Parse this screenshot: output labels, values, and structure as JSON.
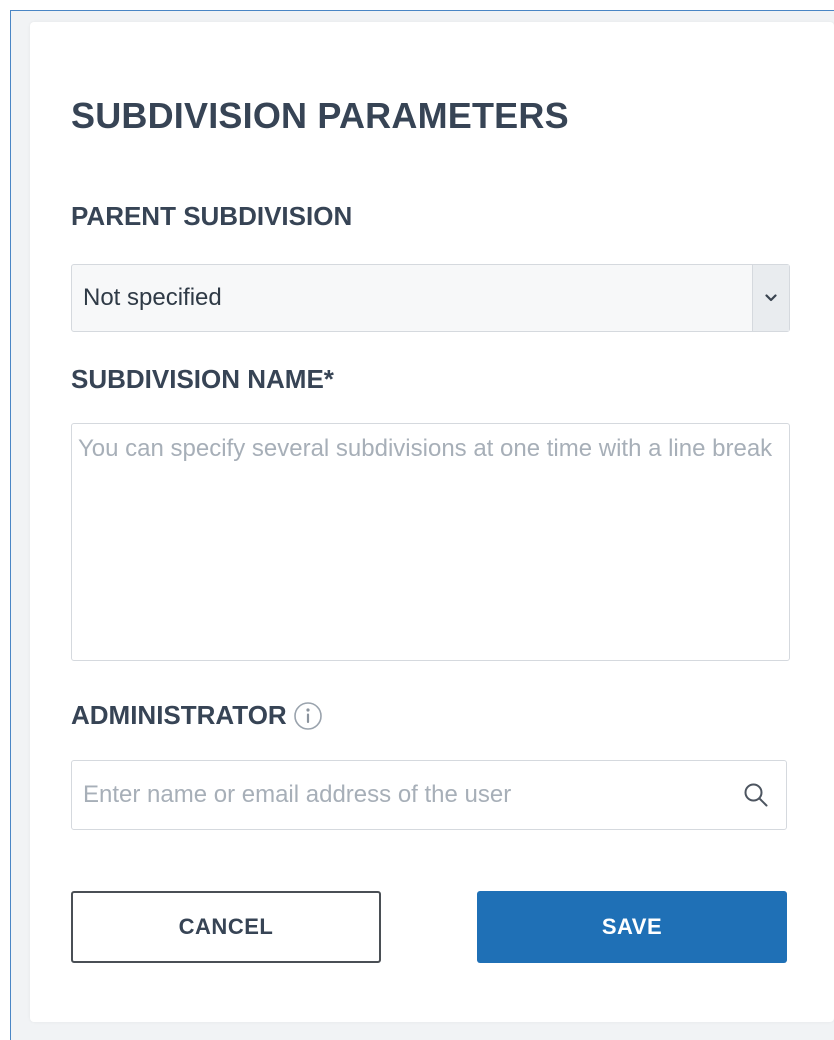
{
  "form": {
    "title": "SUBDIVISION PARAMETERS",
    "parent": {
      "label": "PARENT SUBDIVISION",
      "selected": "Not specified"
    },
    "name": {
      "label": "SUBDIVISION NAME*",
      "value": "",
      "placeholder": "You can specify several subdivisions at one time with a line break"
    },
    "administrator": {
      "label": "ADMINISTRATOR",
      "value": "",
      "placeholder": "Enter name or email address of the user"
    },
    "buttons": {
      "cancel": "CANCEL",
      "save": "SAVE"
    }
  },
  "icons": {
    "select_arrow": "chevron-down-icon",
    "info": "info-icon",
    "search": "search-icon"
  },
  "colors": {
    "accent": "#1f70b6",
    "text": "#374455",
    "placeholder": "#a7afb8",
    "border": "#d5d9de"
  }
}
